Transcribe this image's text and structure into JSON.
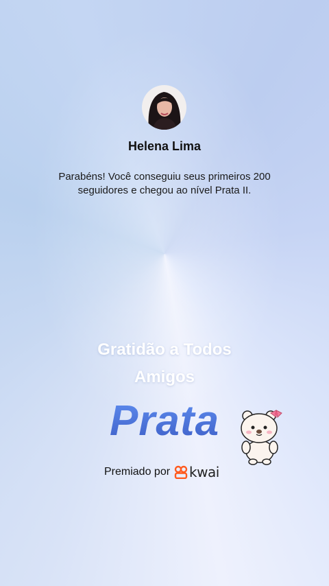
{
  "profile": {
    "name": "Helena Lima",
    "message": "Parabéns! Você conseguiu seus primeiros 200 seguidores e chegou ao nível Prata II."
  },
  "banner": {
    "thanks_line1": "Gratidão a Todos",
    "thanks_line2": "Amigos",
    "level": "Prata"
  },
  "award": {
    "prefix": "Premiado por",
    "brand": "kwai"
  },
  "icons": {
    "avatar": "user-avatar",
    "mascot": "bear-mascot",
    "logo": "kwai-logo-icon"
  },
  "colors": {
    "level": "#4a6fd1",
    "kwai_brand": "#ff5a1f"
  }
}
